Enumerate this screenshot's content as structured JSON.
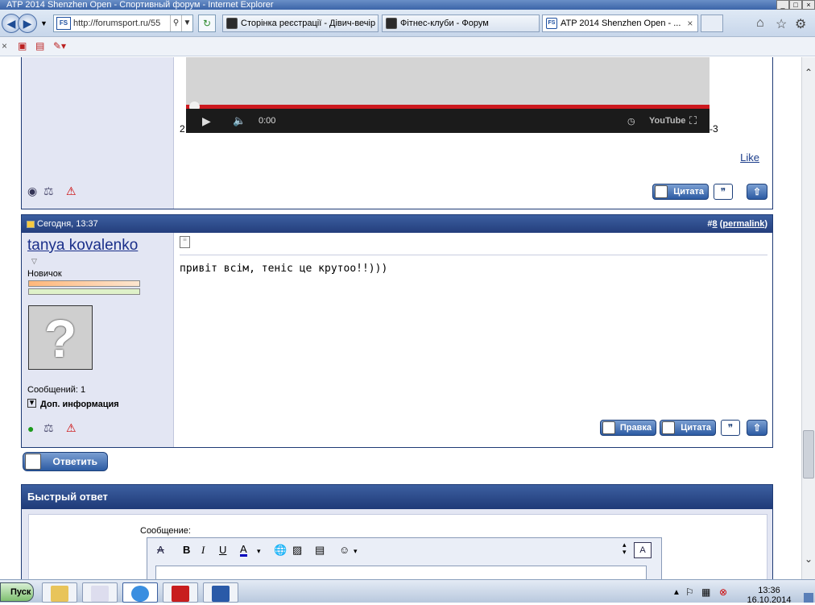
{
  "window": {
    "title": "ATP 2014 Shenzhen Open - Спортивный форум - Internet Explorer",
    "buttons": [
      "_",
      "□",
      "×"
    ]
  },
  "browser": {
    "address": "http://forumsport.ru/55",
    "address_favicon": "FS",
    "tabs": [
      {
        "label": "Сторінка реєстрації - Дівич-вечір"
      },
      {
        "label": "Фітнес-клуби - Форум"
      },
      {
        "label": "ATP 2014 Shenzhen Open - ...",
        "active": true,
        "close": "×"
      }
    ],
    "right_icons": [
      "home-icon",
      "star-icon",
      "gear-icon"
    ]
  },
  "post1": {
    "video": {
      "time": "0:00",
      "logo": "YouTube",
      "left_text": "2",
      "right_text": "-3"
    },
    "like": "Like",
    "buttons": {
      "quote": "Цитата"
    }
  },
  "post2": {
    "date": "Сегодня, 13:37",
    "post_num_prefix": "#",
    "post_num": "8",
    "permalink_open": " (",
    "permalink": "permalink",
    "permalink_close": ")",
    "username": "tanya kovalenko",
    "rank": "Новичок",
    "posts_label": "Сообщений: 1",
    "extra_info": "Доп. информация",
    "message": "привіт всім, теніс це крутоо!!)))",
    "buttons": {
      "edit": "Правка",
      "quote": "Цитата"
    }
  },
  "reply_button": "Ответить",
  "quick_reply": {
    "title": "Быстрый ответ",
    "message_label": "Сообщение:",
    "toolbar": [
      "B",
      "I",
      "U",
      "A"
    ]
  },
  "taskbar": {
    "start": "Пуск",
    "time": "13:36",
    "date": "16.10.2014"
  }
}
